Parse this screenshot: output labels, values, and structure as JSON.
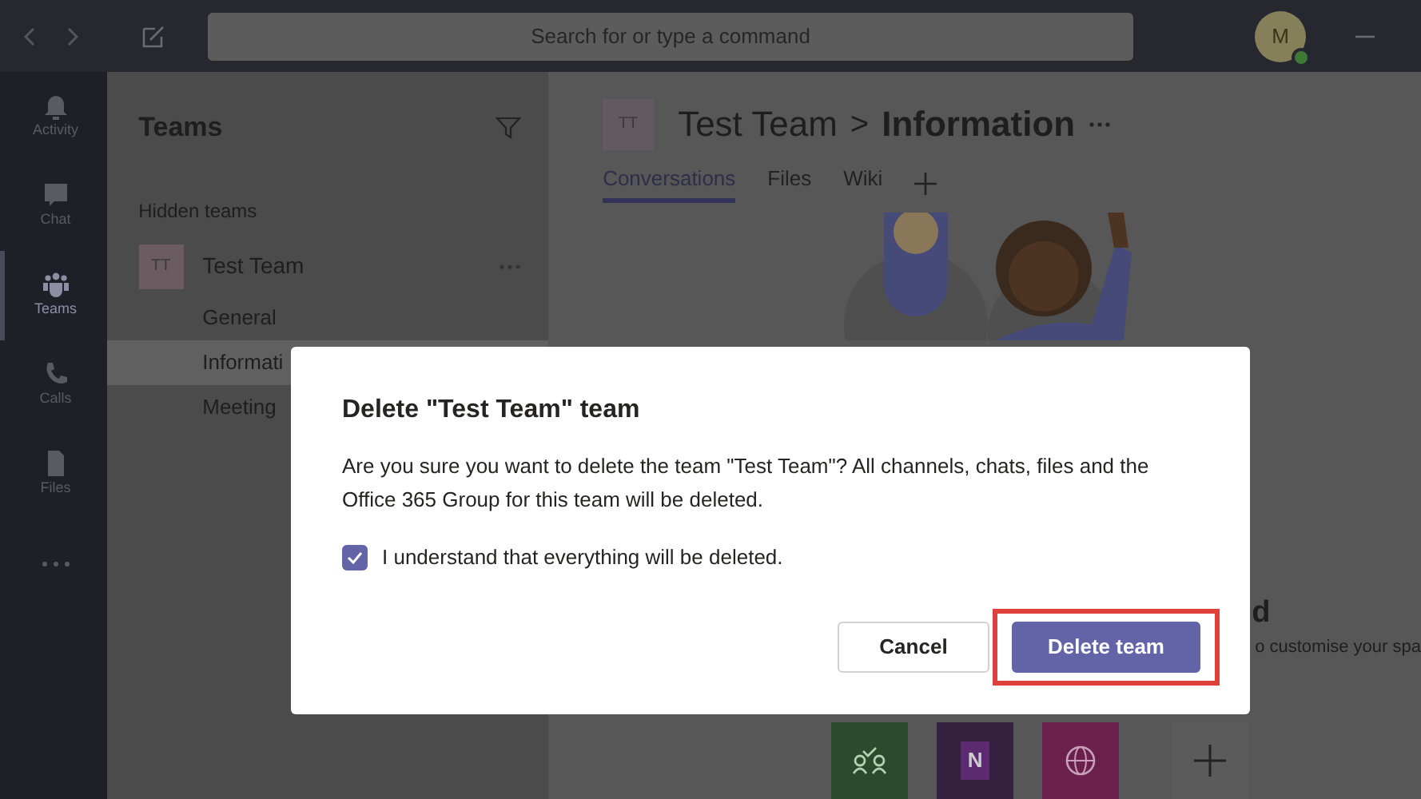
{
  "topbar": {
    "search_placeholder": "Search for or type a command",
    "avatar": "M"
  },
  "rail": [
    {
      "label": "Activity",
      "kind": "bell",
      "selected": false
    },
    {
      "label": "Chat",
      "kind": "chat",
      "selected": false
    },
    {
      "label": "Teams",
      "kind": "teams",
      "selected": true
    },
    {
      "label": "Calls",
      "kind": "phone",
      "selected": false
    },
    {
      "label": "Files",
      "kind": "file",
      "selected": false
    }
  ],
  "sidebar": {
    "title": "Teams",
    "section": "Hidden teams",
    "team": {
      "initials": "TT",
      "name": "Test Team",
      "channels": [
        {
          "name": "General",
          "selected": false
        },
        {
          "name": "Informati",
          "selected": true
        },
        {
          "name": "Meeting",
          "selected": false
        }
      ]
    }
  },
  "header": {
    "initials": "TT",
    "team": "Test Team",
    "separator": ">",
    "channel": "Information"
  },
  "tabs": [
    {
      "label": "Conversations",
      "selected": true
    },
    {
      "label": "Files",
      "selected": false
    },
    {
      "label": "Wiki",
      "selected": false
    }
  ],
  "welcome": {
    "heading": "d",
    "caption": "o customise your spa"
  },
  "apps": [
    {
      "kind": "planner"
    },
    {
      "kind": "onenote",
      "glyph": "N"
    },
    {
      "kind": "website"
    },
    {
      "kind": "add"
    }
  ],
  "dialog": {
    "title": "Delete \"Test Team\" team",
    "message": "Are you sure you want to delete the team \"Test Team\"? All channels, chats, files and the Office 365 Group for this team will be deleted.",
    "checkbox": {
      "label": "I understand that everything will be deleted.",
      "checked": true
    },
    "buttons": [
      {
        "label": "Cancel",
        "kind": "secondary",
        "highlighted": false
      },
      {
        "label": "Delete team",
        "kind": "primary",
        "highlighted": true
      }
    ]
  }
}
